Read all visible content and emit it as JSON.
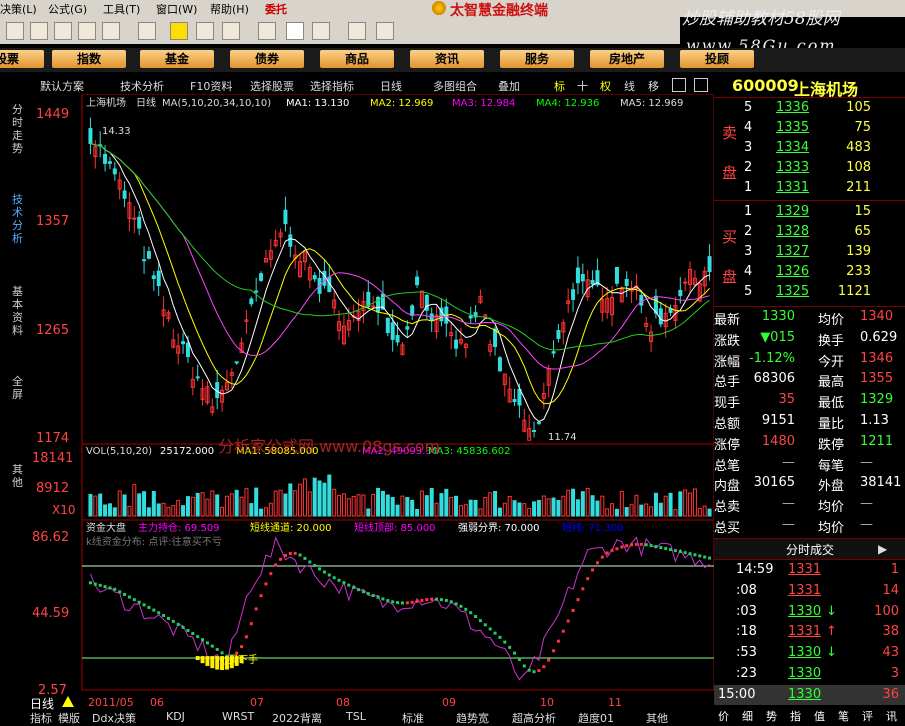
{
  "menu": {
    "items": [
      "决策(L)",
      "公式(G)",
      "工具(T)",
      "窗口(W)",
      "帮助(H)"
    ],
    "delegate_label": "委托",
    "brand_title": "太智慧金融终端",
    "watermark": "炒股辅助教材58股网",
    "watermark_url": "www.58Gu.com"
  },
  "categories": [
    "股票",
    "指数",
    "基金",
    "债券",
    "商品",
    "资讯",
    "服务",
    "房地产",
    "投顾"
  ],
  "analysis_toolbar": {
    "items": [
      "默认方案",
      "技术分析",
      "F10资料",
      "选择股票",
      "选择指标",
      "日线",
      "多图组合",
      "叠加",
      "标",
      "十",
      "权",
      "线",
      "移"
    ]
  },
  "side_tabs": [
    "分时走势",
    "技术分析",
    "基本资料",
    "全屏",
    "其他"
  ],
  "stock": {
    "code": "600009",
    "name": "上海机场",
    "title_label": "上海机场",
    "period": "日线"
  },
  "ma_line": {
    "label": "MA(5,10,20,34,10,10)",
    "ma1": "MA1: 13.130",
    "ma2": "MA2: 12.969",
    "ma3": "MA3: 12.984",
    "ma4": "MA4: 12.936",
    "ma5": "MA5: 12.969"
  },
  "price_axis": [
    "1449",
    "1357",
    "1265",
    "1174"
  ],
  "price_markers": {
    "high": "14.33",
    "low": "11.74"
  },
  "vol_line": {
    "label": "VOL(5,10,20)",
    "vol": "25172.000",
    "ma1": "MA1: 58085.000",
    "ma2": "MA2: 49093.30",
    "ma3": "MA3: 45836.602"
  },
  "vol_axis": [
    "18141",
    "8912",
    "X10"
  ],
  "overlay_text": "分析家公式网 www.08gs.com",
  "ind_line": {
    "name": "资金大盘",
    "main": "主力持仓: 69.509",
    "short": "短线通道: 20.000",
    "top": "短线顶部: 85.000",
    "split": "强弱分界: 70.000",
    "extra": "短线: 71.300",
    "hint": "k线资金分布: 点评:往意买不亏"
  },
  "ind_axis": [
    "86.62",
    "44.59",
    "2.57"
  ],
  "ind_buy_label": "买下手",
  "date_axis": [
    "日线",
    "2011/05",
    "06",
    "07",
    "08",
    "09",
    "10",
    "11"
  ],
  "bottom_tabs": [
    "指标",
    "模版",
    "Ddx决策",
    "KDJ",
    "WRST",
    "2022背离",
    "TSL",
    "标准",
    "趋势宽",
    "超高分析",
    "趋度01",
    "其他"
  ],
  "chart_data": [
    {
      "type": "candlestick",
      "title": "上海机场 日线",
      "ylim": [
        11.74,
        14.49
      ],
      "axis_ticks": [
        14.49,
        13.57,
        12.65,
        11.74
      ],
      "annotations": [
        "14.33",
        "11.74"
      ],
      "series": [
        {
          "name": "MA1",
          "last": 13.13
        },
        {
          "name": "MA2",
          "last": 12.969
        },
        {
          "name": "MA3",
          "last": 12.984
        },
        {
          "name": "MA4",
          "last": 12.936
        },
        {
          "name": "MA5",
          "last": 12.969
        }
      ]
    },
    {
      "type": "bar",
      "title": "VOL(5,10,20)",
      "ylim": [
        0,
        18141
      ],
      "series": [
        {
          "name": "VOL",
          "last": 25172.0
        },
        {
          "name": "MA1",
          "last": 58085.0
        },
        {
          "name": "MA2",
          "last": 49093.3
        },
        {
          "name": "MA3",
          "last": 45836.602
        }
      ]
    },
    {
      "type": "line",
      "title": "资金大盘",
      "ylim": [
        2.57,
        86.62
      ],
      "series": [
        {
          "name": "主力持仓",
          "last": 69.509
        },
        {
          "name": "短线通道",
          "last": 20.0
        },
        {
          "name": "短线顶部",
          "last": 85.0
        },
        {
          "name": "强弱分界",
          "last": 70.0
        }
      ]
    }
  ],
  "order_book": {
    "sell_label": [
      "卖",
      "盘"
    ],
    "buy_label": [
      "买",
      "盘"
    ],
    "sells": [
      {
        "lvl": "5",
        "price": "1336",
        "vol": "105"
      },
      {
        "lvl": "4",
        "price": "1335",
        "vol": "75"
      },
      {
        "lvl": "3",
        "price": "1334",
        "vol": "483"
      },
      {
        "lvl": "2",
        "price": "1333",
        "vol": "108"
      },
      {
        "lvl": "1",
        "price": "1331",
        "vol": "211"
      }
    ],
    "buys": [
      {
        "lvl": "1",
        "price": "1329",
        "vol": "15"
      },
      {
        "lvl": "2",
        "price": "1328",
        "vol": "65"
      },
      {
        "lvl": "3",
        "price": "1327",
        "vol": "139"
      },
      {
        "lvl": "4",
        "price": "1326",
        "vol": "233"
      },
      {
        "lvl": "5",
        "price": "1325",
        "vol": "1121"
      }
    ]
  },
  "stats": [
    {
      "k1": "最新",
      "v1": "1330",
      "c1": "grn",
      "k2": "均价",
      "v2": "1340",
      "c2": "red"
    },
    {
      "k1": "涨跌",
      "v1": "▼015",
      "c1": "grn",
      "k2": "换手",
      "v2": "0.629",
      "c2": "wht"
    },
    {
      "k1": "涨幅",
      "v1": "-1.12%",
      "c1": "grn",
      "k2": "今开",
      "v2": "1346",
      "c2": "red"
    },
    {
      "k1": "总手",
      "v1": "68306",
      "c1": "wht",
      "k2": "最高",
      "v2": "1355",
      "c2": "red"
    },
    {
      "k1": "现手",
      "v1": "35",
      "c1": "red",
      "k2": "最低",
      "v2": "1329",
      "c2": "grn"
    },
    {
      "k1": "总额",
      "v1": "9151",
      "c1": "wht",
      "k2": "量比",
      "v2": "1.13",
      "c2": "wht"
    },
    {
      "k1": "涨停",
      "v1": "1480",
      "c1": "red",
      "k2": "跌停",
      "v2": "1211",
      "c2": "grn"
    },
    {
      "k1": "总笔",
      "v1": "—",
      "c1": "gry",
      "k2": "每笔",
      "v2": "—",
      "c2": "gry"
    },
    {
      "k1": "内盘",
      "v1": "30165",
      "c1": "wht",
      "k2": "外盘",
      "v2": "38141",
      "c2": "wht"
    },
    {
      "k1": "总卖",
      "v1": "—",
      "c1": "gry",
      "k2": "均价",
      "v2": "—",
      "c2": "gry"
    },
    {
      "k1": "总买",
      "v1": "—",
      "c1": "gry",
      "k2": "均价",
      "v2": "—",
      "c2": "gry"
    }
  ],
  "ticks_header": "分时成交",
  "ticks": [
    {
      "t": "14:59",
      "p": "1331",
      "pc": "red",
      "arrow": "",
      "ac": "",
      "v": "1",
      "vc": "red"
    },
    {
      "t": ":08",
      "p": "1331",
      "pc": "red",
      "arrow": "",
      "ac": "",
      "v": "14",
      "vc": "red"
    },
    {
      "t": ":03",
      "p": "1330",
      "pc": "grn",
      "arrow": "↓",
      "ac": "grn",
      "v": "100",
      "vc": "red"
    },
    {
      "t": ":18",
      "p": "1331",
      "pc": "red",
      "arrow": "↑",
      "ac": "red",
      "v": "38",
      "vc": "red"
    },
    {
      "t": ":53",
      "p": "1330",
      "pc": "grn",
      "arrow": "↓",
      "ac": "grn",
      "v": "43",
      "vc": "red"
    },
    {
      "t": ":23",
      "p": "1330",
      "pc": "grn",
      "arrow": "",
      "ac": "",
      "v": "3",
      "vc": "red"
    },
    {
      "t": "15:00",
      "p": "1330",
      "pc": "grn",
      "arrow": "",
      "ac": "",
      "v": "36",
      "vc": "red"
    }
  ],
  "right_bottom_tabs": [
    "价",
    "细",
    "势",
    "指",
    "值",
    "笔",
    "评",
    "讯"
  ]
}
